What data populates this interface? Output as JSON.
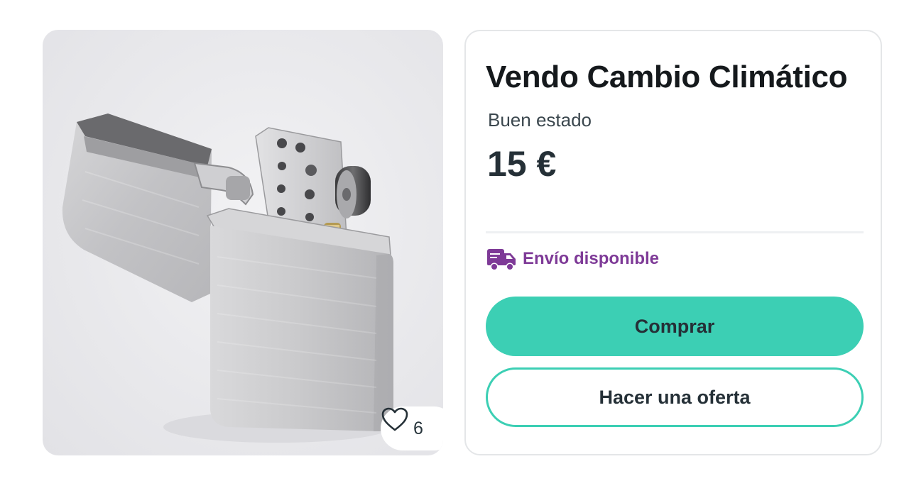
{
  "listing": {
    "title": "Vendo Cambio Climático",
    "condition": "Buen estado",
    "price": "15 €",
    "likes": "6",
    "shipping_label": "Envío disponible"
  },
  "actions": {
    "buy_label": "Comprar",
    "offer_label": "Hacer una oferta"
  },
  "icons": {
    "like": "heart-icon",
    "shipping": "truck-icon"
  },
  "colors": {
    "accent": "#3ccfb4",
    "shipping": "#7e3a97",
    "text": "#253037"
  }
}
